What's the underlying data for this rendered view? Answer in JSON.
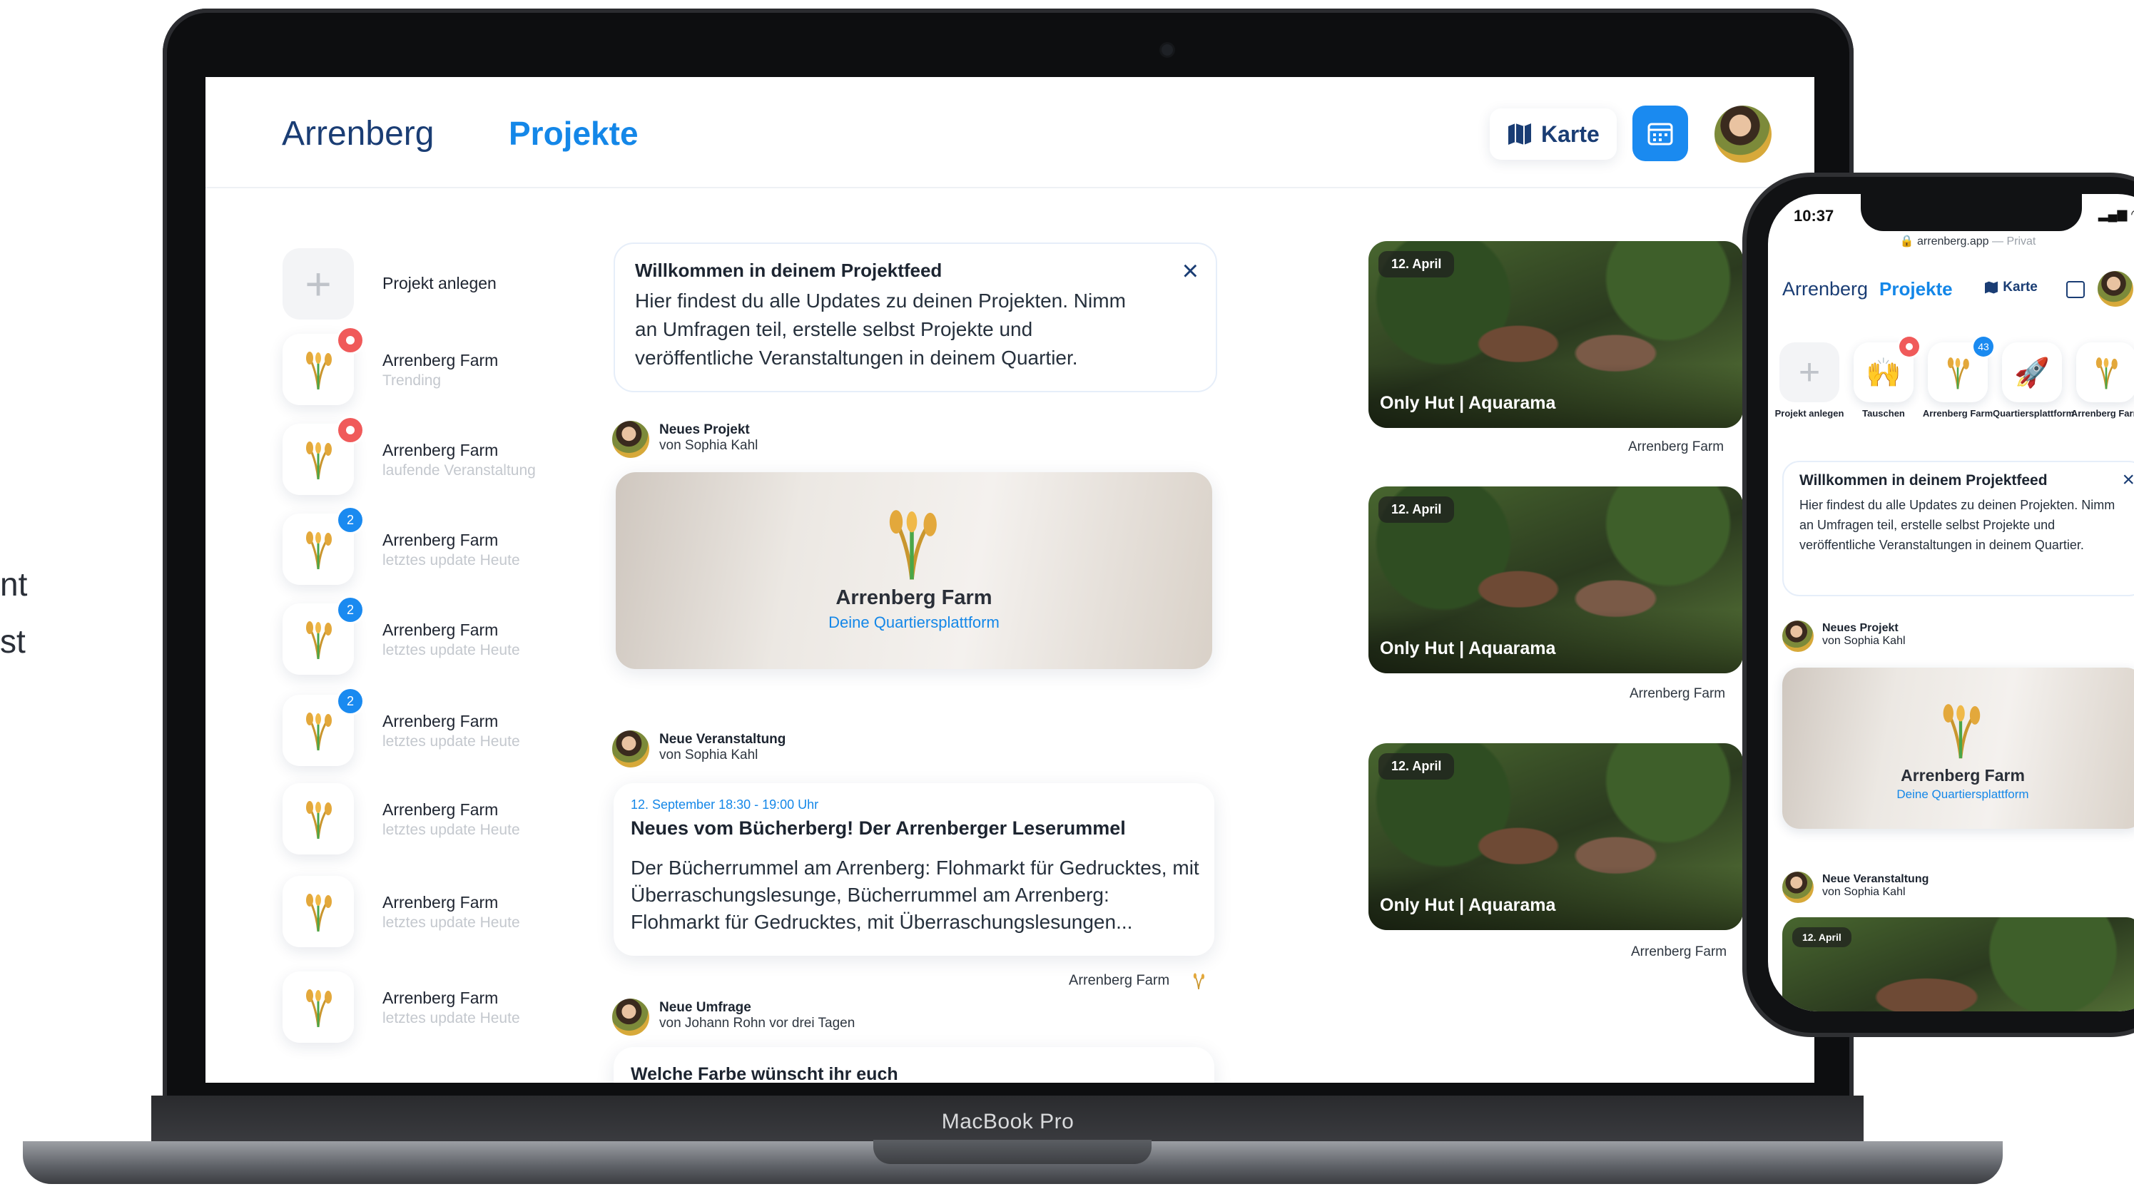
{
  "left_text": {
    "line1": "nt",
    "line2": "st"
  },
  "laptop": {
    "label": "MacBook Pro"
  },
  "desktop": {
    "header": {
      "brand": "Arrenberg",
      "nav_projects": "Projekte",
      "map_label": "Karte",
      "map_icon": "map-icon",
      "calendar_icon": "calendar-icon"
    },
    "sidebar": {
      "create_label": "Projekt anlegen",
      "items": [
        {
          "name": "Arrenberg Farm",
          "sub": "Trending",
          "badge": "dot"
        },
        {
          "name": "Arrenberg Farm",
          "sub": "laufende Veranstaltung",
          "badge": "dot"
        },
        {
          "name": "Arrenberg Farm",
          "sub": "letztes update Heute",
          "badge": "2"
        },
        {
          "name": "Arrenberg Farm",
          "sub": "letztes update Heute",
          "badge": "2"
        },
        {
          "name": "Arrenberg Farm",
          "sub": "letztes update Heute",
          "badge": "2"
        },
        {
          "name": "Arrenberg Farm",
          "sub": "letztes update Heute",
          "badge": ""
        },
        {
          "name": "Arrenberg Farm",
          "sub": "letztes update Heute",
          "badge": ""
        },
        {
          "name": "Arrenberg Farm",
          "sub": "letztes update Heute",
          "badge": ""
        }
      ]
    },
    "welcome": {
      "title": "Willkommen in deinem Projektfeed",
      "text": "Hier findest du alle Updates zu deinen Projekten. Nimm an Umfragen teil, erstelle selbst Projekte und veröffentliche Veranstaltungen in deinem Quartier."
    },
    "post_project": {
      "title": "Neues Projekt",
      "author": "von Sophia Kahl",
      "card_title": "Arrenberg Farm",
      "card_sub": "Deine Quartiersplattform"
    },
    "post_event": {
      "title": "Neue Veranstaltung",
      "author": "von Sophia Kahl",
      "date": "12. September     18:30 - 19:00 Uhr",
      "event_title": "Neues vom Bücherberg! Der Arrenberger Leserummel",
      "body": "Der Bücherrummel am Arrenberg: Flohmarkt für Gedrucktes, mit Überraschungslesunge, Bücherrummel am Arrenberg: Flohmarkt für Gedrucktes, mit Überraschungslesungen...",
      "footer": "Arrenberg Farm"
    },
    "post_poll": {
      "title": "Neue Umfrage",
      "author": "von Johann Rohn vor drei Tagen",
      "question": "Welche Farbe wünscht ihr euch"
    },
    "event_tiles": [
      {
        "date": "12. April",
        "title": "Only Hut | Aquarama",
        "footer": "Arrenberg Farm"
      },
      {
        "date": "12. April",
        "title": "Only Hut | Aquarama",
        "footer": "Arrenberg Farm"
      },
      {
        "date": "12. April",
        "title": "Only Hut | Aquarama",
        "footer": "Arrenberg Farm"
      }
    ]
  },
  "phone": {
    "time": "10:37",
    "url": "arrenberg.app",
    "url_suffix": "— Privat",
    "brand": "Arrenberg",
    "nav_projects": "Projekte",
    "map_label": "Karte",
    "tiles": [
      {
        "label": "Projekt anlegen",
        "icon": "plus-icon",
        "badge": ""
      },
      {
        "label": "Tauschen",
        "icon": "raised-hands-icon",
        "badge": "dot"
      },
      {
        "label": "Arrenberg Farm",
        "icon": "wheat-icon",
        "badge": "43"
      },
      {
        "label": "Quartiersplattform",
        "icon": "rocket-icon",
        "badge": ""
      },
      {
        "label": "Arrenberg Farm",
        "icon": "wheat-icon",
        "badge": ""
      }
    ],
    "welcome": {
      "title": "Willkommen in deinem Projektfeed",
      "text": "Hier findest du alle Updates zu deinen Projekten. Nimm an Umfragen teil, erstelle selbst Projekte und veröffentliche Veranstaltungen in deinem Quartier."
    },
    "post_project": {
      "title": "Neues Projekt",
      "author": "von Sophia Kahl",
      "card_title": "Arrenberg Farm",
      "card_sub": "Deine Quartiersplattform"
    },
    "post_event": {
      "title": "Neue Veranstaltung",
      "author": "von Sophia Kahl",
      "date": "12. April"
    }
  },
  "colors": {
    "accent": "#1487e8",
    "brand_dark": "#1a3d74",
    "badge_red": "#f05a5a",
    "badge_blue": "#1a8af0"
  }
}
